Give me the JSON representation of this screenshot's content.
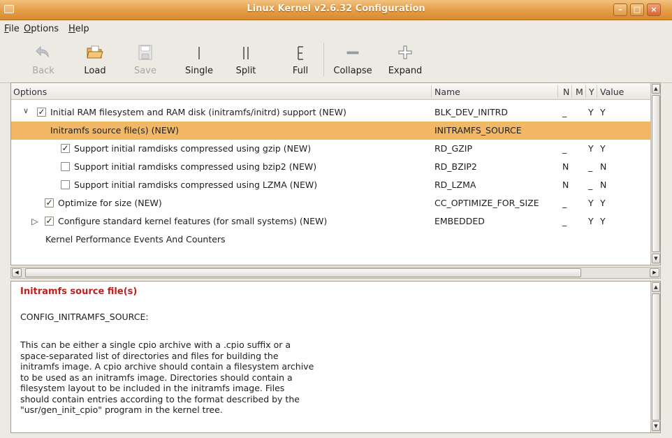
{
  "window": {
    "title": "Linux Kernel v2.6.32 Configuration",
    "controls": [
      "minimize",
      "maximize",
      "close"
    ]
  },
  "menu": [
    {
      "label": "File",
      "mnemonic": "F",
      "rest": "ile"
    },
    {
      "label": "Options",
      "mnemonic": "O",
      "rest": "ptions"
    },
    {
      "label": "Help",
      "mnemonic": "H",
      "rest": "elp"
    }
  ],
  "toolbar": {
    "back": "Back",
    "load": "Load",
    "save": "Save",
    "single": "Single",
    "split": "Split",
    "full": "Full",
    "collapse": "Collapse",
    "expand": "Expand"
  },
  "tree": {
    "columns": {
      "options": "Options",
      "name": "Name",
      "n": "N",
      "m": "M",
      "y": "Y",
      "value": "Value"
    },
    "rows": [
      {
        "label": "Initial RAM filesystem and RAM disk (initramfs/initrd) support (NEW)",
        "name": "BLK_DEV_INITRD",
        "n": "_",
        "m": "",
        "y": "Y",
        "value": "Y",
        "checked": true,
        "expander": "expanded"
      },
      {
        "label": "Initramfs source file(s) (NEW)",
        "name": "INITRAMFS_SOURCE",
        "n": "",
        "m": "",
        "y": "",
        "value": "",
        "selected": true
      },
      {
        "label": "Support initial ramdisks compressed using gzip (NEW)",
        "name": "RD_GZIP",
        "n": "_",
        "m": "",
        "y": "Y",
        "value": "Y",
        "checked": true
      },
      {
        "label": "Support initial ramdisks compressed using bzip2 (NEW)",
        "name": "RD_BZIP2",
        "n": "N",
        "m": "",
        "y": "_",
        "value": "N",
        "checked": false
      },
      {
        "label": "Support initial ramdisks compressed using LZMA (NEW)",
        "name": "RD_LZMA",
        "n": "N",
        "m": "",
        "y": "_",
        "value": "N",
        "checked": false
      },
      {
        "label": "Optimize for size (NEW)",
        "name": "CC_OPTIMIZE_FOR_SIZE",
        "n": "_",
        "m": "",
        "y": "Y",
        "value": "Y",
        "checked": true
      },
      {
        "label": "Configure standard kernel features (for small systems) (NEW)",
        "name": "EMBEDDED",
        "n": "_",
        "m": "",
        "y": "Y",
        "value": "Y",
        "checked": true,
        "expander": "collapsed"
      },
      {
        "label": "Kernel Performance Events And Counters",
        "name": "",
        "n": "",
        "m": "",
        "y": "",
        "value": ""
      }
    ]
  },
  "help": {
    "title": "Initramfs source file(s)",
    "symbol": "CONFIG_INITRAMFS_SOURCE:",
    "body": [
      "This can be either a single cpio archive with a .cpio suffix or a",
      "space-separated list of directories and files for building the",
      "initramfs image.  A cpio archive should contain a filesystem archive",
      "to be used as an initramfs image.  Directories should contain a",
      "filesystem layout to be included in the initramfs image.  Files",
      "should contain entries according to the format described by the",
      "\"usr/gen_init_cpio\" program in the kernel tree."
    ]
  },
  "colors": {
    "titlebar": "#e6a24e",
    "selection": "#f2b865",
    "help_title": "#c01f1f"
  }
}
